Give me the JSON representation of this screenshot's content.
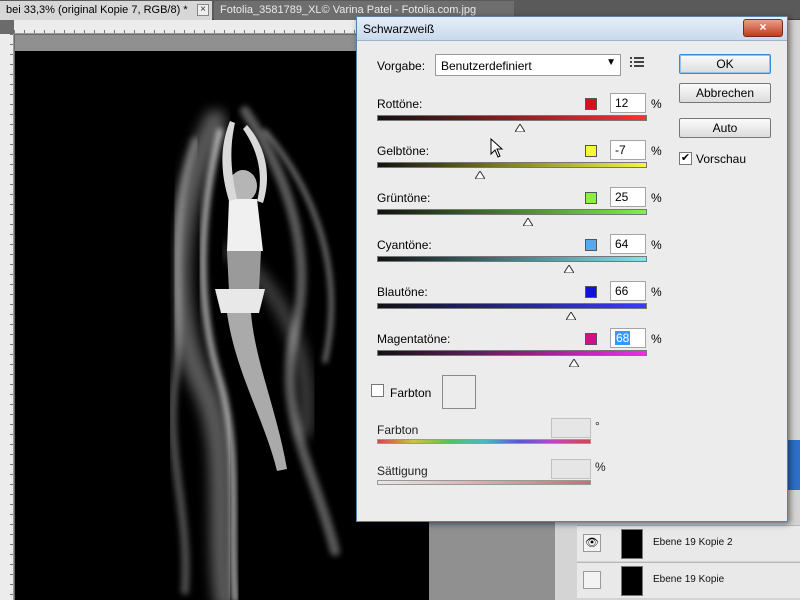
{
  "tabs": [
    {
      "label": "bei 33,3% (original Kopie 7, RGB/8) *",
      "close": "×"
    },
    {
      "label": "Fotolia_3581789_XL© Varina Patel - Fotolia.com.jpg"
    }
  ],
  "dialog": {
    "title": "Schwarzweiß",
    "close_symbol": "×",
    "preset_label": "Vorgabe:",
    "preset_value": "Benutzerdefiniert",
    "preset_arrow": "▼",
    "preset_menu_icon": "list-icon",
    "sliders": [
      {
        "label": "Rottöne:",
        "value": "12",
        "unit": "%",
        "color": "#d8101c",
        "level": 0.53,
        "gradient": [
          "#111111",
          "#ff3030"
        ]
      },
      {
        "label": "Gelbtöne:",
        "value": "-7",
        "unit": "%",
        "color": "#f8f83a",
        "level": 0.38,
        "gradient": [
          "#111111",
          "#f6f640"
        ]
      },
      {
        "label": "Grüntöne:",
        "value": "25",
        "unit": "%",
        "color": "#8cf040",
        "level": 0.56,
        "gradient": [
          "#111111",
          "#80f050"
        ]
      },
      {
        "label": "Cyantöne:",
        "value": "64",
        "unit": "%",
        "color": "#5aa8ec",
        "level": 0.71,
        "gradient": [
          "#111111",
          "#7ae8f0"
        ]
      },
      {
        "label": "Blautöne:",
        "value": "66",
        "unit": "%",
        "color": "#1010e0",
        "level": 0.72,
        "gradient": [
          "#111111",
          "#3a3aff"
        ]
      },
      {
        "label": "Magentatöne:",
        "value": "68",
        "unit": "%",
        "color": "#d0108c",
        "level": 0.73,
        "gradient": [
          "#111111",
          "#ee30e0"
        ]
      }
    ],
    "hue_toggle_label": "Farbton",
    "hue": {
      "label": "Farbton",
      "unit": "°"
    },
    "saturation": {
      "label": "Sättigung",
      "unit": "%"
    },
    "buttons": {
      "ok": "OK",
      "cancel": "Abbrechen",
      "auto": "Auto"
    },
    "preview": {
      "label": "Vorschau",
      "checked": true
    }
  },
  "layers": [
    {
      "name": "Ebene 19 Kopie 2",
      "visible": true
    },
    {
      "name": "Ebene 19 Kopie",
      "visible": false
    }
  ]
}
